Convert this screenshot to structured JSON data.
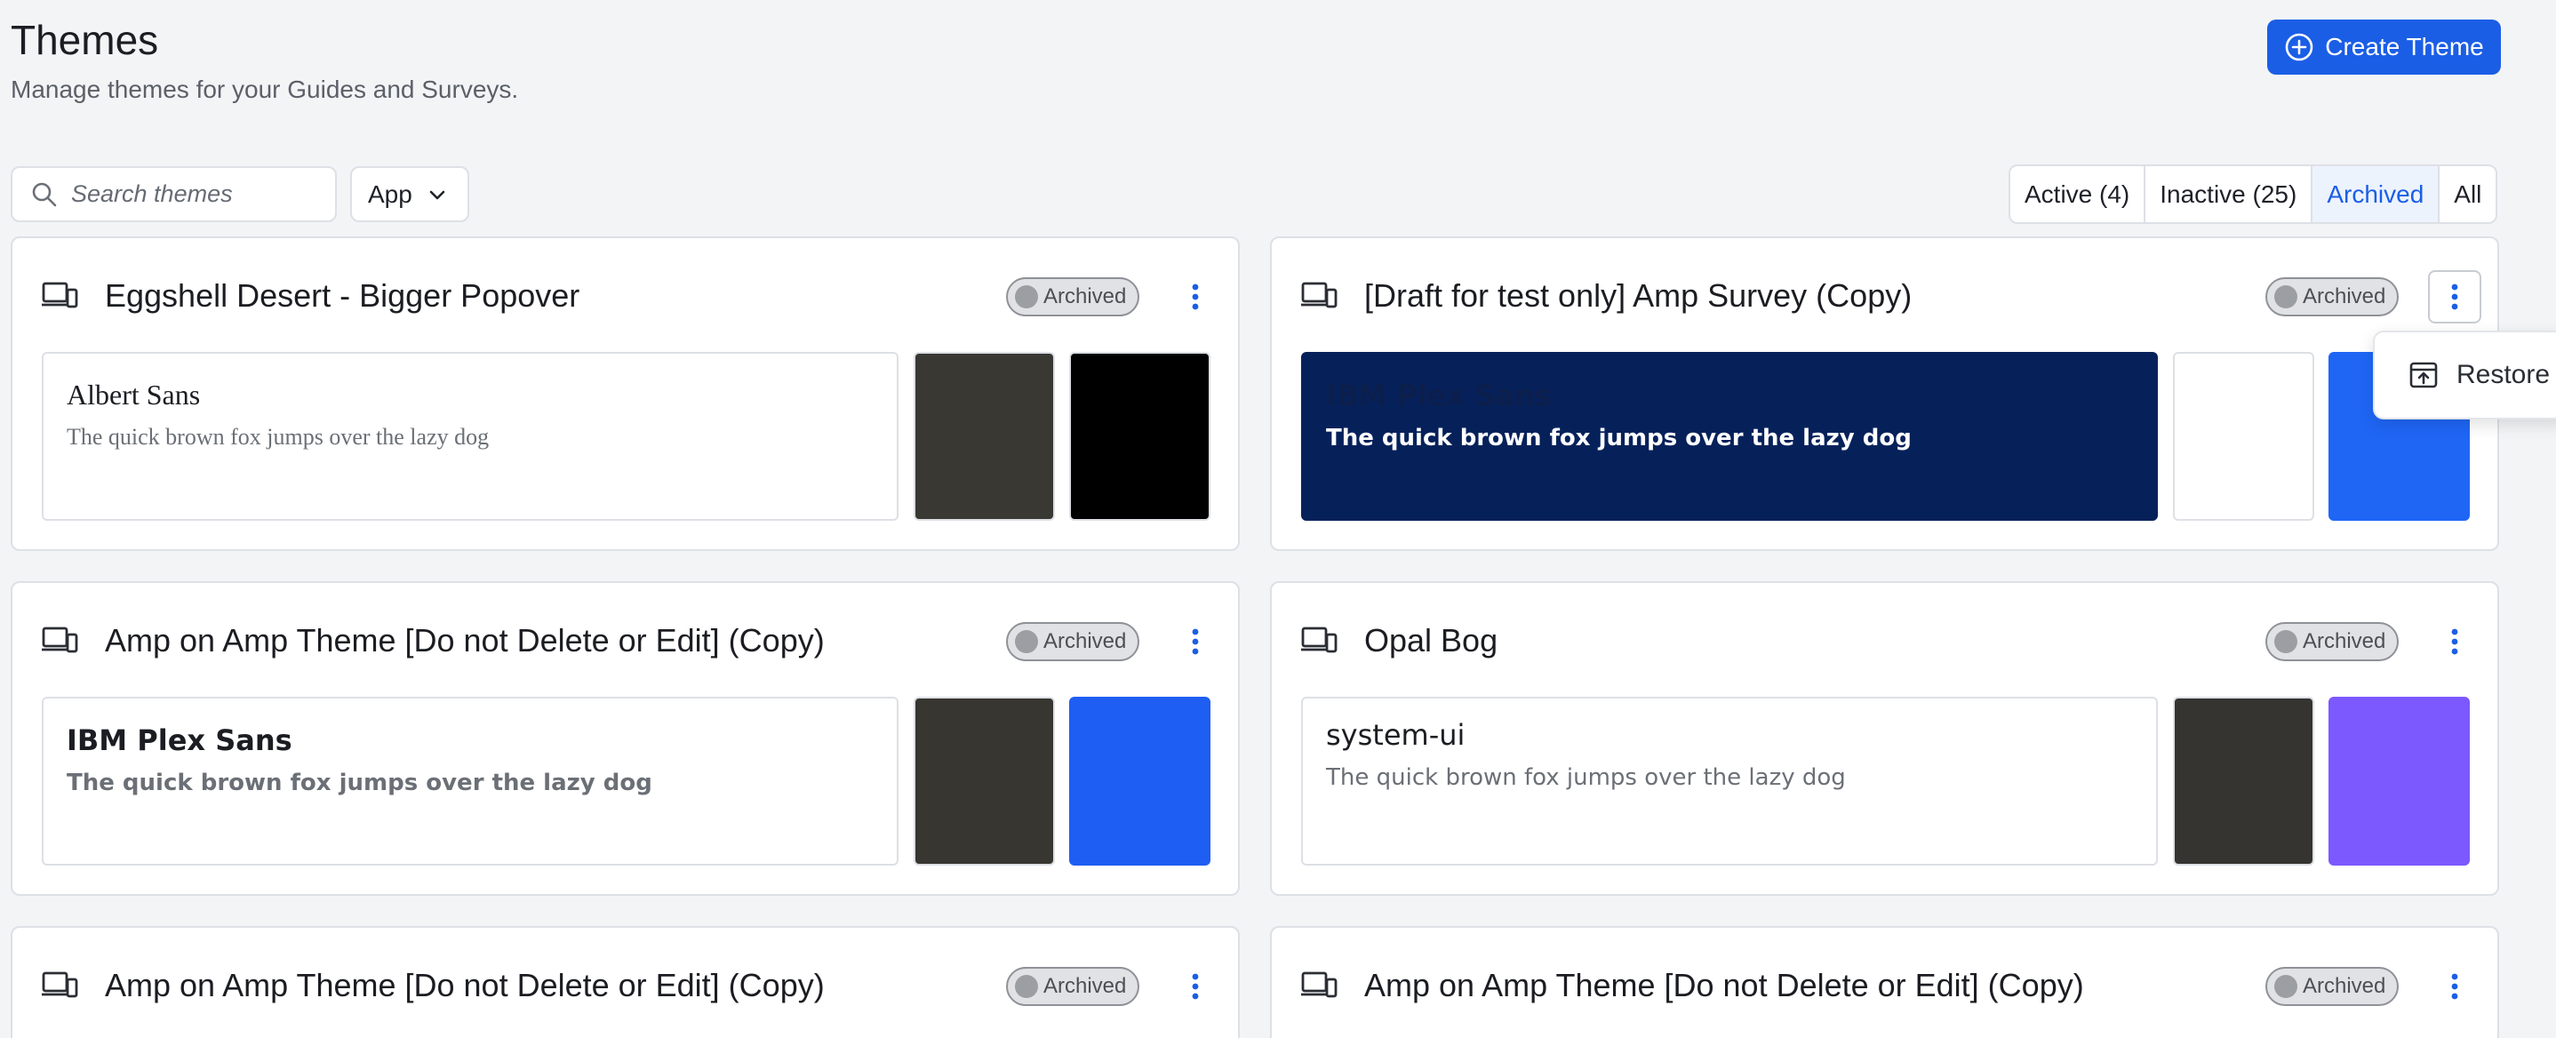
{
  "header": {
    "title": "Themes",
    "subtitle": "Manage themes for your Guides and Surveys.",
    "create_label": "Create Theme"
  },
  "toolbar": {
    "search_placeholder": "Search themes",
    "app_select_value": "App",
    "filters": [
      {
        "label": "Active (4)",
        "active": false
      },
      {
        "label": "Inactive (25)",
        "active": false
      },
      {
        "label": "Archived",
        "active": true
      },
      {
        "label": "All",
        "active": false
      }
    ]
  },
  "colors": {
    "primary": "#1b5ee6",
    "archived_badge_bg": "#e1e2e5"
  },
  "cards": [
    {
      "title": "Eggshell Desert - Bigger Popover",
      "status": "Archived",
      "font_name": "Albert Sans",
      "sample_text": "The quick brown fox jumps over the lazy dog",
      "swatches": [
        "#3a3833",
        "#000000"
      ]
    },
    {
      "title": "[Draft for test only] Amp Survey (Copy)",
      "status": "Archived",
      "font_name": "IBM Plex Sans",
      "sample_text": "The quick brown fox jumps over the lazy dog",
      "swatches": [
        "#ffffff",
        "#1f66f5"
      ]
    },
    {
      "title": "Amp on Amp Theme [Do not Delete or Edit] (Copy)",
      "status": "Archived",
      "font_name": "IBM Plex Sans",
      "sample_text": "The quick brown fox jumps over the lazy dog",
      "swatches": [
        "#383630",
        "#1f5ef2"
      ]
    },
    {
      "title": "Opal Bog",
      "status": "Archived",
      "font_name": "system-ui",
      "sample_text": "The quick brown fox jumps over the lazy dog",
      "swatches": [
        "#353431",
        "#7b59ff"
      ]
    },
    {
      "title": "Amp on Amp Theme [Do not Delete or Edit] (Copy)",
      "status": "Archived"
    },
    {
      "title": "Amp on Amp Theme [Do not Delete or Edit] (Copy)",
      "status": "Archived"
    }
  ],
  "menu": {
    "restore_label": "Restore"
  }
}
